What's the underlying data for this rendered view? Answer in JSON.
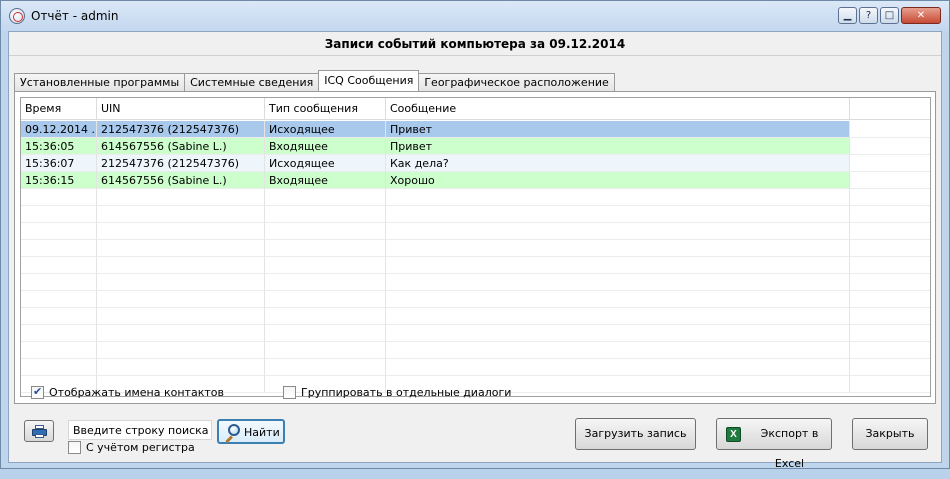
{
  "window": {
    "title": "Отчёт - admin"
  },
  "header": {
    "title": "Записи событий компьютера за 09.12.2014"
  },
  "tabs": [
    {
      "label": "Установленные программы",
      "active": false
    },
    {
      "label": "Системные сведения",
      "active": false
    },
    {
      "label": "ICQ Сообщения",
      "active": true
    },
    {
      "label": "Географическое расположение",
      "active": false
    }
  ],
  "table": {
    "columns": [
      "Время",
      "UIN",
      "Тип сообщения",
      "Сообщение"
    ],
    "rows": [
      {
        "time": "09.12.2014 ...",
        "uin": "212547376 (212547376)",
        "type": "Исходящее",
        "message": "Привет",
        "style": "sel"
      },
      {
        "time": "15:36:05",
        "uin": "614567556 (Sabine L.)",
        "type": "Входящее",
        "message": "Привет",
        "style": "green"
      },
      {
        "time": "15:36:07",
        "uin": "212547376 (212547376)",
        "type": "Исходящее",
        "message": "Как дела?",
        "style": "alt"
      },
      {
        "time": "15:36:15",
        "uin": "614567556 (Sabine L.)",
        "type": "Входящее",
        "message": "Хорошо",
        "style": "green"
      }
    ]
  },
  "options": {
    "show_contact_names": {
      "label": "Отображать имена контактов",
      "checked": true
    },
    "group_dialogs": {
      "label": "Группировать в отдельные диалоги",
      "checked": false
    }
  },
  "search": {
    "value": "Введите строку поиска",
    "find_label": "Найти",
    "case_label": "С учётом регистра",
    "case_checked": false
  },
  "buttons": {
    "load": "Загрузить запись",
    "excel": "Экспорт в Excel",
    "close": "Закрыть"
  },
  "colors": {
    "selected_row": "#a8c8ec",
    "incoming_row": "#ccffcc",
    "alt_row": "#eef6fb"
  }
}
